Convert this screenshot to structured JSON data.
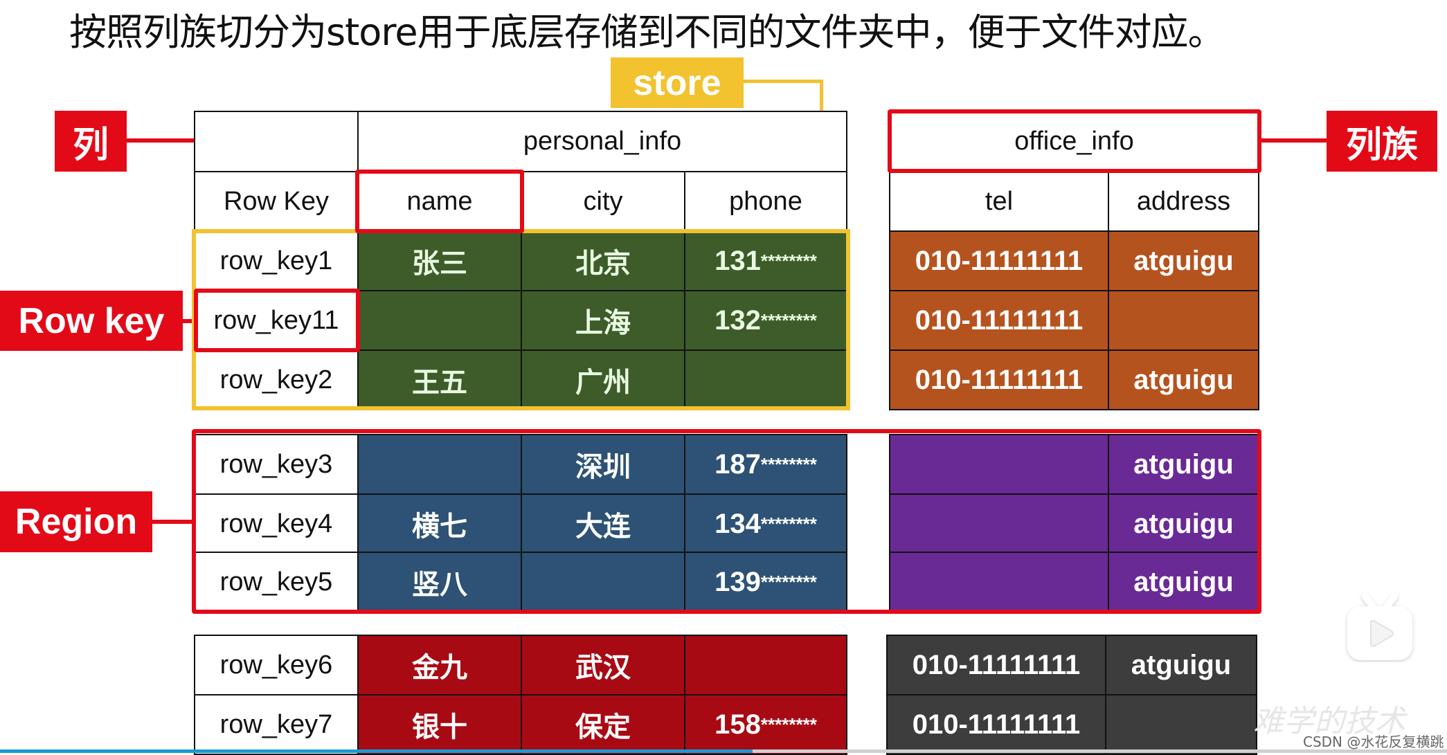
{
  "title": "按照列族切分为store用于底层存储到不同的文件夹中，便于文件对应。",
  "labels": {
    "column": "列",
    "column_family": "列族",
    "row_key": "Row key",
    "region": "Region",
    "store": "store"
  },
  "table": {
    "column_families": [
      "personal_info",
      "office_info"
    ],
    "headers": [
      "Row Key",
      "name",
      "city",
      "phone",
      "tel",
      "address"
    ],
    "groups": [
      {
        "left_color": "#3d5c2a",
        "right_color": "#b5531f",
        "rows": [
          {
            "row_key": "row_key1",
            "name": "张三",
            "city": "北京",
            "phone_prefix": "131",
            "phone_mask": "********",
            "tel": "010-11111111",
            "address": "atguigu"
          },
          {
            "row_key": "row_key11",
            "name": "",
            "city": "上海",
            "phone_prefix": "132",
            "phone_mask": "********",
            "tel": "010-11111111",
            "address": ""
          },
          {
            "row_key": "row_key2",
            "name": "王五",
            "city": "广州",
            "phone_prefix": "",
            "phone_mask": "",
            "tel": "010-11111111",
            "address": "atguigu"
          }
        ]
      },
      {
        "left_color": "#2d5275",
        "right_color": "#6a2a96",
        "rows": [
          {
            "row_key": "row_key3",
            "name": "",
            "city": "深圳",
            "phone_prefix": "187",
            "phone_mask": "********",
            "tel": "",
            "address": "atguigu"
          },
          {
            "row_key": "row_key4",
            "name": "横七",
            "city": "大连",
            "phone_prefix": "134",
            "phone_mask": "********",
            "tel": "",
            "address": "atguigu"
          },
          {
            "row_key": "row_key5",
            "name": "竖八",
            "city": "",
            "phone_prefix": "139",
            "phone_mask": "********",
            "tel": "",
            "address": "atguigu"
          }
        ]
      },
      {
        "left_color": "#a80a14",
        "right_color": "#3d3d3d",
        "rows": [
          {
            "row_key": "row_key6",
            "name": "金九",
            "city": "武汉",
            "phone_prefix": "",
            "phone_mask": "",
            "tel": "010-11111111",
            "address": "atguigu"
          },
          {
            "row_key": "row_key7",
            "name": "银十",
            "city": "保定",
            "phone_prefix": "158",
            "phone_mask": "********",
            "tel": "010-11111111",
            "address": ""
          }
        ]
      }
    ]
  },
  "colors": {
    "highlight_red": "#e30a18",
    "store_yellow": "#f2c22f"
  },
  "player": {
    "progress_percent": 52,
    "play_icon": "tv-play-icon"
  },
  "watermark": {
    "faded_text": "难学的技术",
    "credit": "CSDN @水花反复横跳"
  }
}
